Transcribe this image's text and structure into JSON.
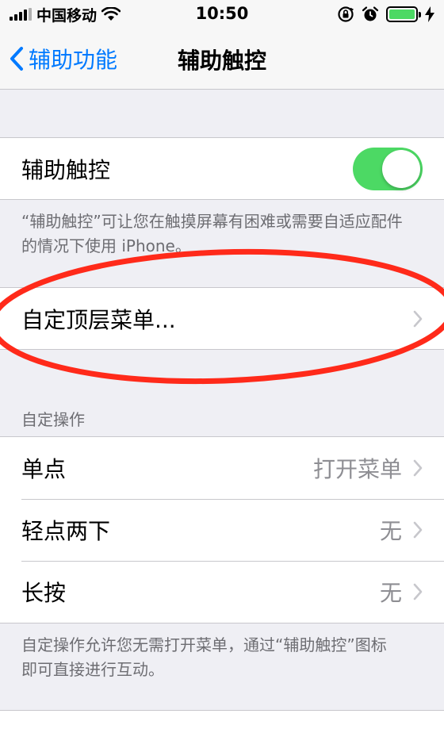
{
  "status_bar": {
    "carrier": "中国移动",
    "time": "10:50"
  },
  "nav": {
    "back_label": "辅助功能",
    "title": "辅助触控"
  },
  "assistive_touch": {
    "label": "辅助触控",
    "toggle_on": true,
    "footnote": "“辅助触控”可让您在触摸屏幕有困难或需要自适应配件的情况下使用 iPhone。"
  },
  "custom_menu": {
    "label": "自定顶层菜单..."
  },
  "custom_actions": {
    "header": "自定操作",
    "items": [
      {
        "label": "单点",
        "value": "打开菜单"
      },
      {
        "label": "轻点两下",
        "value": "无"
      },
      {
        "label": "长按",
        "value": "无"
      }
    ],
    "footnote": "自定操作允许您无需打开菜单，通过“辅助触控”图标即可直接进行互动。"
  },
  "colors": {
    "accent": "#007aff",
    "toggle_on": "#4cd964",
    "annotation": "#ff2a1a"
  }
}
